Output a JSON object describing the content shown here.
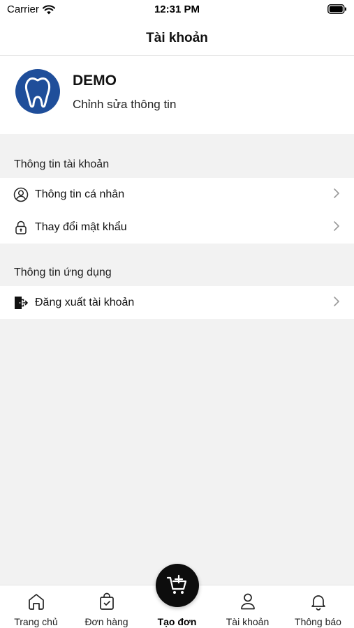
{
  "status_bar": {
    "carrier": "Carrier",
    "time": "12:31 PM"
  },
  "header": {
    "title": "Tài khoản"
  },
  "profile": {
    "name": "DEMO",
    "edit_label": "Chỉnh sửa thông tin",
    "avatar_color": "#1f4e9a"
  },
  "sections": {
    "account": {
      "title": "Thông tin tài khoản",
      "items": [
        {
          "label": "Thông tin cá nhân",
          "icon": "user-circle-icon"
        },
        {
          "label": "Thay đổi mật khẩu",
          "icon": "lock-icon"
        }
      ]
    },
    "app": {
      "title": "Thông tin ứng dụng",
      "items": [
        {
          "label": "Đăng xuất tài khoản",
          "icon": "logout-icon"
        }
      ]
    }
  },
  "tabs": [
    {
      "label": "Trang chủ",
      "icon": "home-icon"
    },
    {
      "label": "Đơn hàng",
      "icon": "shopping-bag-icon"
    },
    {
      "label": "Tạo đơn",
      "icon": "add-cart-icon",
      "active": true
    },
    {
      "label": "Tài khoản",
      "icon": "person-icon"
    },
    {
      "label": "Thông báo",
      "icon": "bell-icon"
    }
  ]
}
